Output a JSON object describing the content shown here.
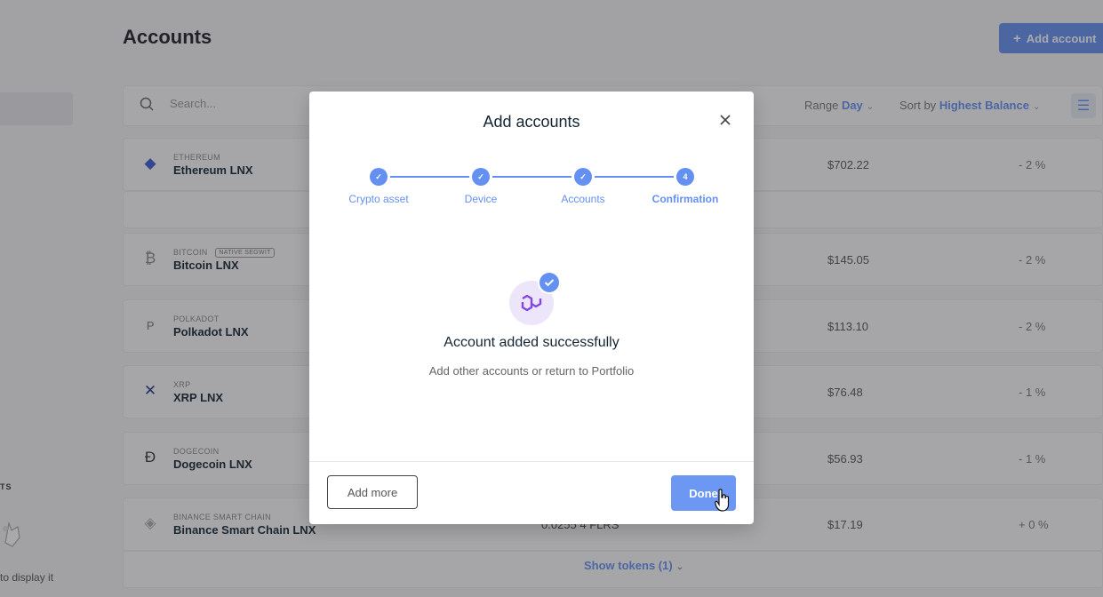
{
  "page": {
    "title": "Accounts",
    "add_account_label": "Add account",
    "search_placeholder": "Search...",
    "range_label": "Range",
    "range_value": "Day",
    "sort_label": "Sort by",
    "sort_value": "Highest Balance",
    "left_heading": "TS",
    "left_caption": "to display it",
    "show_tokens_label": "Show tokens (1)",
    "partial_balance": "0.0255 4 FLRS"
  },
  "accounts": [
    {
      "ticker": "ETHEREUM",
      "name": "Ethereum LNX",
      "tag": "",
      "balance": "$702.22",
      "change": "- 2 %",
      "icon": "ethereum-icon"
    },
    {
      "ticker": "BITCOIN",
      "name": "Bitcoin LNX",
      "tag": "NATIVE SEGWIT",
      "balance": "$145.05",
      "change": "- 2 %",
      "icon": "bitcoin-icon"
    },
    {
      "ticker": "POLKADOT",
      "name": "Polkadot LNX",
      "tag": "",
      "balance": "$113.10",
      "change": "- 2 %",
      "icon": "polkadot-icon"
    },
    {
      "ticker": "XRP",
      "name": "XRP LNX",
      "tag": "",
      "balance": "$76.48",
      "change": "- 1 %",
      "icon": "xrp-icon"
    },
    {
      "ticker": "DOGECOIN",
      "name": "Dogecoin LNX",
      "tag": "",
      "balance": "$56.93",
      "change": "- 1 %",
      "icon": "dogecoin-icon"
    },
    {
      "ticker": "BINANCE SMART CHAIN",
      "name": "Binance Smart Chain LNX",
      "tag": "",
      "balance": "$17.19",
      "change": "+ 0 %",
      "icon": "binance-icon"
    }
  ],
  "modal": {
    "title": "Add accounts",
    "steps": [
      {
        "label": "Crypto asset",
        "state": "done"
      },
      {
        "label": "Device",
        "state": "done"
      },
      {
        "label": "Accounts",
        "state": "done"
      },
      {
        "label": "Confirmation",
        "state": "current",
        "number": "4"
      }
    ],
    "success_title": "Account added successfully",
    "success_subtitle": "Add other accounts or return to Portfolio",
    "add_more_label": "Add more",
    "done_label": "Done"
  },
  "colors": {
    "accent": "#6490f1",
    "polygon_bg": "#ede6fa",
    "polygon": "#8247e5"
  }
}
